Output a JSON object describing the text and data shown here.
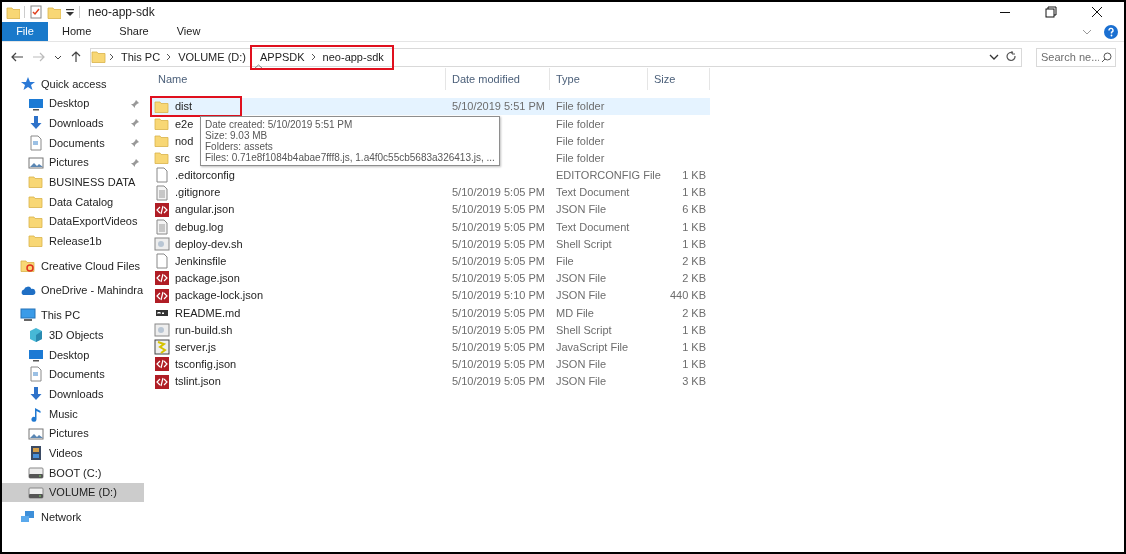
{
  "window": {
    "title": "neo-app-sdk"
  },
  "ribbon_tabs": [
    {
      "label": "File",
      "selected": true
    },
    {
      "label": "Home",
      "selected": false
    },
    {
      "label": "Share",
      "selected": false
    },
    {
      "label": "View",
      "selected": false
    }
  ],
  "address_bar": {
    "crumbs": [
      {
        "label": "This PC",
        "highlighted": false
      },
      {
        "label": "VOLUME (D:)",
        "highlighted": false
      },
      {
        "label": "APPSDK",
        "highlighted": true
      },
      {
        "label": "neo-app-sdk",
        "highlighted": true
      }
    ]
  },
  "search": {
    "placeholder": "Search ne..."
  },
  "sidebar": {
    "items": [
      {
        "label": "Quick access",
        "kind": "star",
        "selected": false,
        "pinned": false,
        "children": [
          {
            "label": "Desktop",
            "kind": "desktop",
            "selected": false,
            "pinned": true
          },
          {
            "label": "Downloads",
            "kind": "download",
            "selected": false,
            "pinned": true
          },
          {
            "label": "Documents",
            "kind": "document",
            "selected": false,
            "pinned": true
          },
          {
            "label": "Pictures",
            "kind": "pictures",
            "selected": false,
            "pinned": true
          },
          {
            "label": "BUSINESS DATA",
            "kind": "folder",
            "selected": false,
            "pinned": false
          },
          {
            "label": "Data Catalog",
            "kind": "folder",
            "selected": false,
            "pinned": false
          },
          {
            "label": "DataExportVideos",
            "kind": "folder",
            "selected": false,
            "pinned": false
          },
          {
            "label": "Release1b",
            "kind": "folder",
            "selected": false,
            "pinned": false
          }
        ]
      },
      {
        "label": "Creative Cloud Files",
        "kind": "cloudfolder",
        "selected": false,
        "pinned": false
      },
      {
        "label": "OneDrive - Mahindra",
        "kind": "cloud",
        "selected": false,
        "pinned": false
      },
      {
        "label": "This PC",
        "kind": "pc",
        "selected": false,
        "pinned": false,
        "children": [
          {
            "label": "3D Objects",
            "kind": "cube",
            "selected": false,
            "pinned": false
          },
          {
            "label": "Desktop",
            "kind": "desktop",
            "selected": false,
            "pinned": false
          },
          {
            "label": "Documents",
            "kind": "document",
            "selected": false,
            "pinned": false
          },
          {
            "label": "Downloads",
            "kind": "download",
            "selected": false,
            "pinned": false
          },
          {
            "label": "Music",
            "kind": "music",
            "selected": false,
            "pinned": false
          },
          {
            "label": "Pictures",
            "kind": "pictures",
            "selected": false,
            "pinned": false
          },
          {
            "label": "Videos",
            "kind": "video",
            "selected": false,
            "pinned": false
          },
          {
            "label": "BOOT (C:)",
            "kind": "drive",
            "selected": false,
            "pinned": false
          },
          {
            "label": "VOLUME (D:)",
            "kind": "drive",
            "selected": true,
            "pinned": false
          }
        ]
      },
      {
        "label": "Network",
        "kind": "network",
        "selected": false,
        "pinned": false
      }
    ]
  },
  "table": {
    "columns": [
      "Name",
      "Date modified",
      "Type",
      "Size"
    ],
    "rows": [
      {
        "name": "dist",
        "kind": "folder",
        "date": "5/10/2019 5:51 PM",
        "type": "File folder",
        "selected": true,
        "highlighted": true
      },
      {
        "name": "e2e",
        "kind": "folder",
        "type": "File folder",
        "selected": false,
        "highlighted": false
      },
      {
        "name": "nod",
        "kind": "folder",
        "type": "File folder",
        "selected": false,
        "highlighted": false
      },
      {
        "name": "src",
        "kind": "folder",
        "type": "File folder",
        "selected": false,
        "highlighted": false
      },
      {
        "name": ".editorconfig",
        "kind": "blank",
        "type": "EDITORCONFIG File",
        "size": "1 KB",
        "selected": false,
        "highlighted": false
      },
      {
        "name": ".gitignore",
        "kind": "text",
        "date": "5/10/2019 5:05 PM",
        "type": "Text Document",
        "size": "1 KB",
        "selected": false,
        "highlighted": false
      },
      {
        "name": "angular.json",
        "kind": "json",
        "date": "5/10/2019 5:05 PM",
        "type": "JSON File",
        "size": "6 KB",
        "selected": false,
        "highlighted": false
      },
      {
        "name": "debug.log",
        "kind": "text",
        "date": "5/10/2019 5:05 PM",
        "type": "Text Document",
        "size": "1 KB",
        "selected": false,
        "highlighted": false
      },
      {
        "name": "deploy-dev.sh",
        "kind": "script",
        "date": "5/10/2019 5:05 PM",
        "type": "Shell Script",
        "size": "1 KB",
        "selected": false,
        "highlighted": false
      },
      {
        "name": "Jenkinsfile",
        "kind": "blank",
        "date": "5/10/2019 5:05 PM",
        "type": "File",
        "size": "2 KB",
        "selected": false,
        "highlighted": false
      },
      {
        "name": "package.json",
        "kind": "json",
        "date": "5/10/2019 5:05 PM",
        "type": "JSON File",
        "size": "2 KB",
        "selected": false,
        "highlighted": false
      },
      {
        "name": "package-lock.json",
        "kind": "json",
        "date": "5/10/2019 5:10 PM",
        "type": "JSON File",
        "size": "440 KB",
        "selected": false,
        "highlighted": false
      },
      {
        "name": "README.md",
        "kind": "md",
        "date": "5/10/2019 5:05 PM",
        "type": "MD File",
        "size": "2 KB",
        "selected": false,
        "highlighted": false
      },
      {
        "name": "run-build.sh",
        "kind": "script",
        "date": "5/10/2019 5:05 PM",
        "type": "Shell Script",
        "size": "1 KB",
        "selected": false,
        "highlighted": false
      },
      {
        "name": "server.js",
        "kind": "js",
        "date": "5/10/2019 5:05 PM",
        "type": "JavaScript File",
        "size": "1 KB",
        "selected": false,
        "highlighted": false
      },
      {
        "name": "tsconfig.json",
        "kind": "json",
        "date": "5/10/2019 5:05 PM",
        "type": "JSON File",
        "size": "1 KB",
        "selected": false,
        "highlighted": false
      },
      {
        "name": "tslint.json",
        "kind": "json",
        "date": "5/10/2019 5:05 PM",
        "type": "JSON File",
        "size": "3 KB",
        "selected": false,
        "highlighted": false
      }
    ]
  },
  "tooltip": {
    "lines": [
      "Date created: 5/10/2019 5:51 PM",
      "Size: 9.03 MB",
      "Folders: assets",
      "Files: 0.71e8f1084b4abae7fff8.js, 1.a4f0c55cb5683a326413.js, ..."
    ]
  }
}
